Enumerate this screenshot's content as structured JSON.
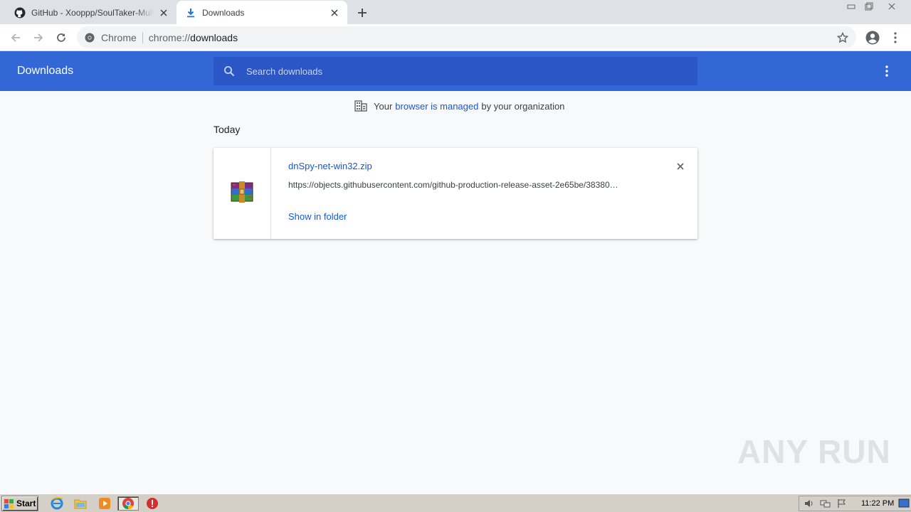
{
  "tabs": [
    {
      "title": "GitHub - Xooppp/SoulTaker-Multitool",
      "icon": "github-icon",
      "active": false
    },
    {
      "title": "Downloads",
      "icon": "download-icon",
      "active": true
    }
  ],
  "omnibox": {
    "chip": "Chrome",
    "scheme": "chrome://",
    "path": "downloads"
  },
  "header": {
    "title": "Downloads",
    "search_placeholder": "Search downloads"
  },
  "managed_notice": {
    "prefix": "Your",
    "link": "browser is managed",
    "suffix": "by your organization"
  },
  "section_label": "Today",
  "download": {
    "filename": "dnSpy-net-win32.zip",
    "url": "https://objects.githubusercontent.com/github-production-release-asset-2e65be/38380…",
    "action": "Show in folder",
    "file_icon": "winrar-archive-icon"
  },
  "watermark": "ANY RUN",
  "taskbar": {
    "start_label": "Start",
    "clock": "11:22 PM"
  },
  "colors": {
    "header_blue": "#3367d6",
    "search_blue": "#2a56c6",
    "link_blue": "#1558d6"
  }
}
